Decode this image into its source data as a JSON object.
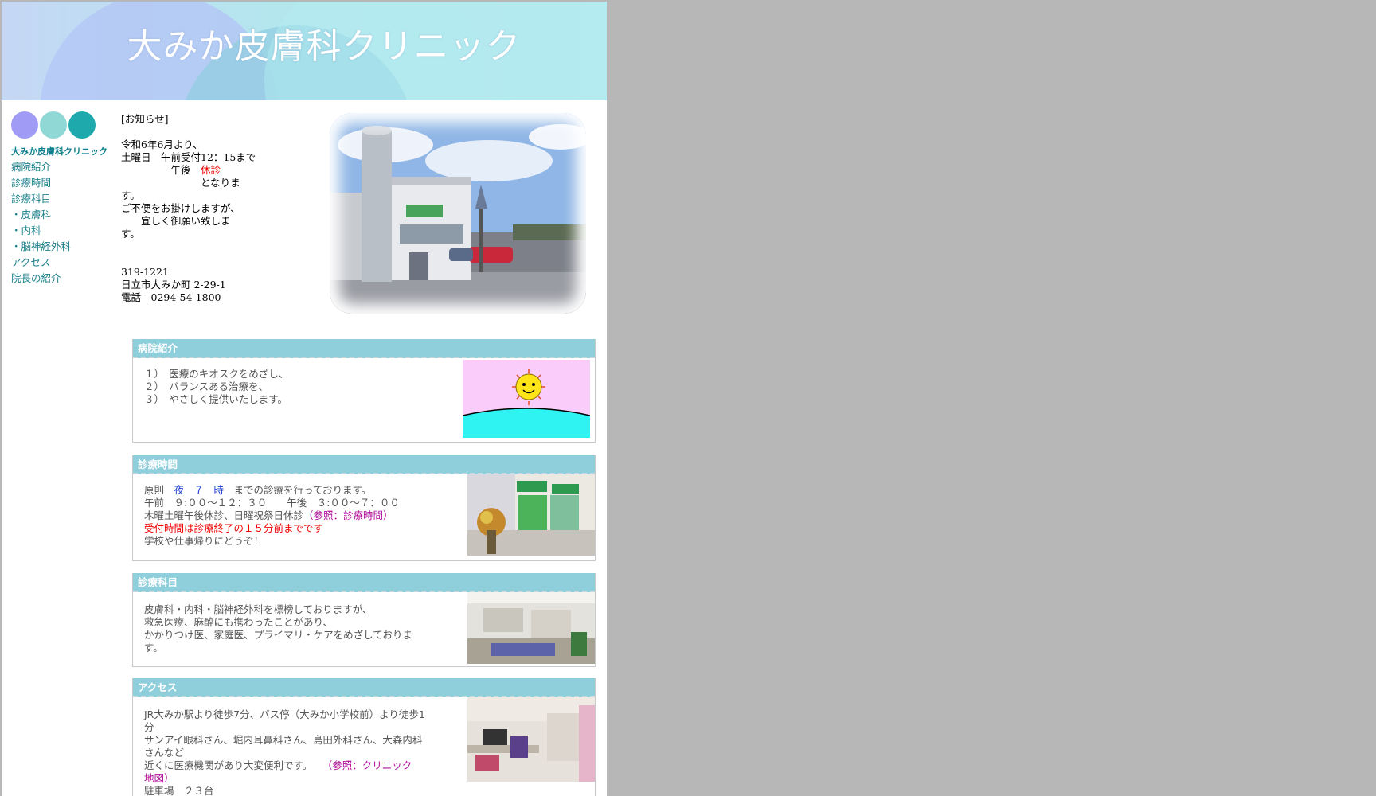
{
  "header": {
    "title": "大みか皮膚科クリニック"
  },
  "sidebar": {
    "circle_colors": [
      "#a09cf5",
      "#8fd8d6",
      "#1ea9ad"
    ],
    "title": "大みか皮膚科クリニック",
    "items": [
      {
        "label": "病院紹介"
      },
      {
        "label": "診療時間"
      },
      {
        "label": "診療科目"
      },
      {
        "label": "・皮膚科"
      },
      {
        "label": "・内科"
      },
      {
        "label": "・脳神経外科"
      },
      {
        "label": "アクセス"
      },
      {
        "label": "院長の紹介"
      }
    ]
  },
  "notice": {
    "heading": "[お知らせ]",
    "l1": "令和6年6月より、",
    "l2": "土曜日　午前受付12：15まで",
    "l3a": "　　　　　午後　",
    "l3b": "休診",
    "l4": "　　　　　　　　となりま",
    "l5": "す。",
    "l6": "ご不便をお掛けしますが、",
    "l7": "　　宜しく御願い致しま",
    "l8": "す。"
  },
  "address": {
    "zip": "319-1221",
    "street": "日立市大みか町 2-29-1",
    "tel": "電話　0294-54-1800"
  },
  "sections": {
    "intro": {
      "title": "病院紹介",
      "l1": "１）　医療のキオスクをめざし、",
      "l2": "２）　バランスある治療を、",
      "l3": "３）　やさしく提供いたします。"
    },
    "hours": {
      "title": "診療時間",
      "l1a": "原則　",
      "l1b": "夜　７　時",
      "l1c": "　までの診療を行っております。",
      "l2": "午前　９:００～１２：３０　　午後　３:００～７：００",
      "l3a": "木曜土曜午後休診、日曜祝祭日休診",
      "l3b": "（参照：診療時間）",
      "l4": "受付時間は診療終了の１５分前までです",
      "l5": "学校や仕事帰りにどうぞ！"
    },
    "depts": {
      "title": "診療科目",
      "l1": "皮膚科・内科・脳神経外科を標榜しておりますが、",
      "l2": "救急医療、麻酔にも携わったことがあり、",
      "l3": "かかりつけ医、家庭医、プライマリ・ケアをめざしておりま",
      "l4": "す。"
    },
    "access": {
      "title": "アクセス",
      "l1": "JR大みか駅より徒歩7分、バス停（大みか小学校前）より徒歩1",
      "l2": "分",
      "l3": "サンアイ眼科さん、堀内耳鼻科さん、島田外科さん、大森内科",
      "l4": "さんなど",
      "l5a": "近くに医療機関があり大変便利です。　　",
      "l5b": "（参照：クリニック",
      "l6": "地図）",
      "l7": "駐車場　２３台"
    }
  }
}
